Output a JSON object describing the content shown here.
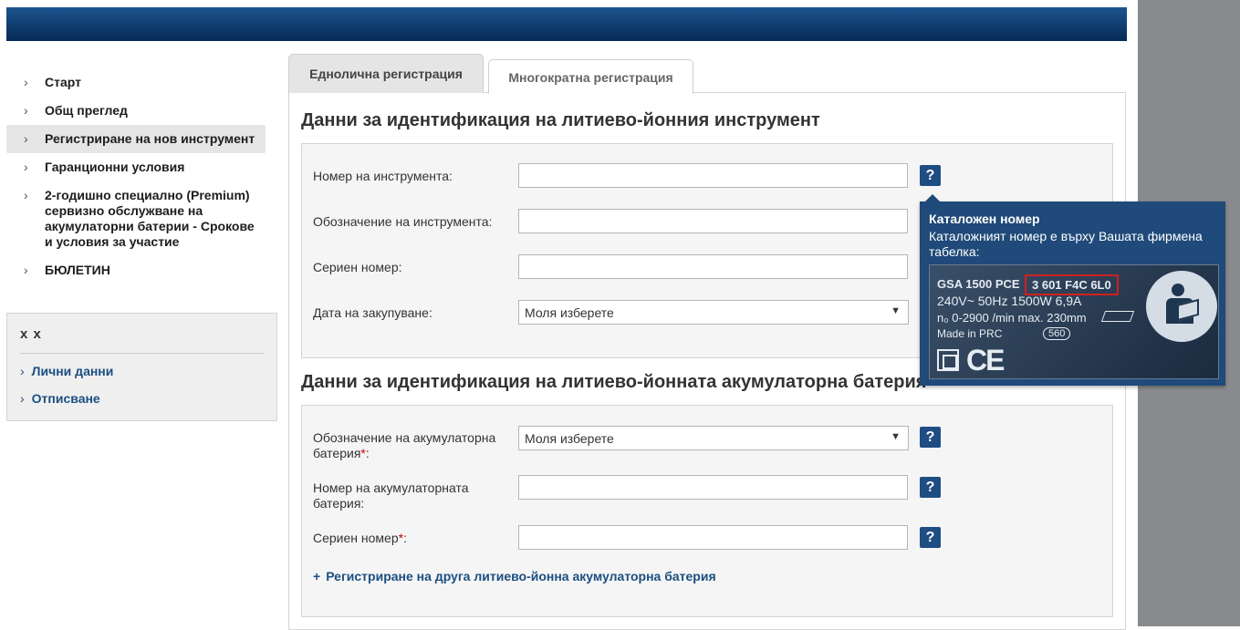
{
  "sidebar": {
    "items": [
      {
        "label": "Старт"
      },
      {
        "label": "Общ преглед"
      },
      {
        "label": "Регистриране на нов инструмент"
      },
      {
        "label": "Гаранционни условия"
      },
      {
        "label": "2-годишно специално (Premium) сервизно обслужване на акумулаторни батерии - Срокове и условия за участие"
      },
      {
        "label": "БЮЛЕТИН"
      }
    ],
    "active_index": 2
  },
  "userbox": {
    "title": "x x",
    "links": [
      {
        "label": "Лични данни"
      },
      {
        "label": "Отписване"
      }
    ]
  },
  "tabs": [
    {
      "label": "Еднолична регистрация",
      "active": true
    },
    {
      "label": "Многократна регистрация",
      "active": false
    }
  ],
  "tool_section": {
    "title": "Данни за идентификация на литиево-йонния инструмент",
    "fields": {
      "tool_number": {
        "label": "Номер на инструмента:",
        "value": ""
      },
      "tool_designation": {
        "label": "Обозначение на инструмента:",
        "value": ""
      },
      "serial_number": {
        "label": "Сериен номер:",
        "value": ""
      },
      "purchase_date": {
        "label": "Дата на закупуване:",
        "selected": "Моля изберете"
      }
    }
  },
  "battery_section": {
    "title": "Данни за идентификация на литиево-йонната акумулаторна батерия",
    "fields": {
      "battery_designation": {
        "label": "Обозначение на акумулаторна батерия",
        "selected": "Моля изберете"
      },
      "battery_number": {
        "label": "Номер на акумулаторната батерия:",
        "value": ""
      },
      "serial_number": {
        "label": "Сериен номер",
        "value": ""
      }
    },
    "required_mark": "*",
    "colon": ":",
    "add_link": "Регистриране на друга литиево-йонна акумулаторна батерия"
  },
  "help_icon_glyph": "?",
  "tooltip": {
    "title": "Каталожен номер",
    "text": "Каталожният номер е върху Вашата фирмена табелка:",
    "plate": {
      "model": "GSA 1500 PCE",
      "catalog_number": "3 601 F4C 6L0",
      "spec_line1": "240V~  50Hz  1500W  6,9A",
      "spec_line2": "n₀ 0-2900 /min   max. 230mm",
      "made_in": "Made in PRC",
      "badge": "560",
      "ce_mark": "CE"
    }
  },
  "colors": {
    "header": "#0a3466",
    "accent": "#1e4d84",
    "link": "#1b4f80",
    "required": "#cc0000"
  }
}
